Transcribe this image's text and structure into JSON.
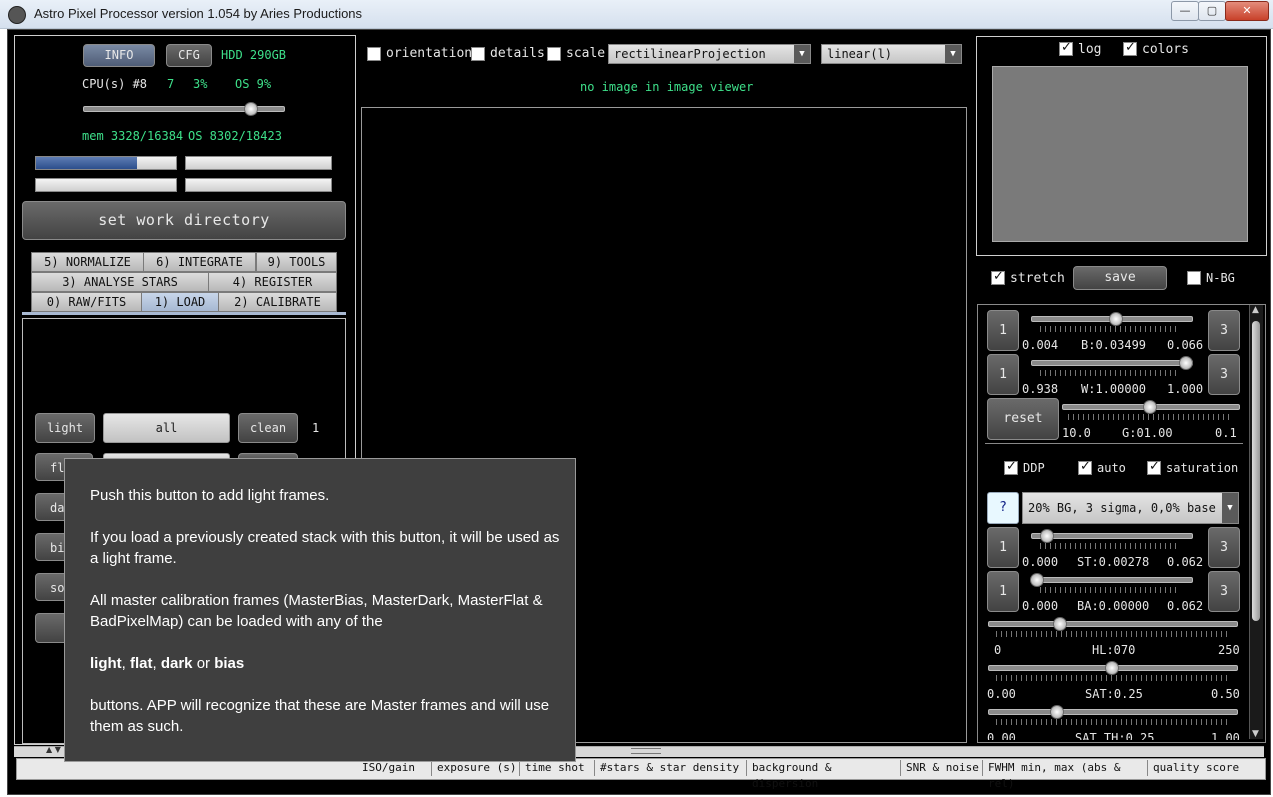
{
  "window": {
    "title": "Astro Pixel Processor version 1.054 by Aries Productions",
    "minimize_label": "—",
    "maximize_label": "▢",
    "close_label": "✕"
  },
  "sysinfo": {
    "info_label": "INFO",
    "cfg_label": "CFG",
    "hdd": "HDD 290GB",
    "cpu_label": "CPU(s) #8",
    "cpu_threads": "7",
    "cpu_pct": "3%",
    "os_cpu": "OS 9%",
    "mem": "mem 3328/16384",
    "os_mem": "OS 8302/18423",
    "thread_slider": 0.84,
    "progress_1": 0.72
  },
  "work_dir_label": "set work directory",
  "tabs": {
    "row1": [
      "5) NORMALIZE",
      "6) INTEGRATE",
      "9) TOOLS"
    ],
    "row2": [
      "3) ANALYSE STARS",
      "4) REGISTER"
    ],
    "row3": [
      "0) RAW/FITS",
      "1) LOAD",
      "2) CALIBRATE"
    ],
    "selected": "1) LOAD"
  },
  "load_panel": {
    "light_label": "light",
    "all_label": "all",
    "clean_label": "clean",
    "count": "1",
    "flat_partial": "fl",
    "dark_partial": "da",
    "bias_partial": "bi",
    "sort_partial": "so"
  },
  "viewer": {
    "orientation_label": "orientation",
    "details_label": "details",
    "scale_label": "scale",
    "projection": "rectilinearProjection",
    "stretch_mode": "linear(l)",
    "message": "no image in image viewer"
  },
  "histogram": {
    "log_label": "log",
    "colors_label": "colors",
    "log_checked": true,
    "colors_checked": true
  },
  "stretch_controls": {
    "stretch_label": "stretch",
    "save_label": "save",
    "nbg_label": "N-BG",
    "stretch_checked": true,
    "nbg_checked": false,
    "b_row": {
      "left": "1",
      "right": "3",
      "min": "0.004",
      "value": "B:0.03499",
      "max": "0.066",
      "pos": 0.53
    },
    "w_row": {
      "left": "1",
      "right": "3",
      "min": "0.938",
      "value": "W:1.00000",
      "max": "1.000",
      "pos": 0.97
    },
    "g_row": {
      "reset": "reset",
      "min": "10.0",
      "value": "G:01.00",
      "max": "0.1",
      "pos": 0.5
    },
    "ddp_label": "DDP",
    "auto_label": "auto",
    "saturation_label": "saturation",
    "ddp_checked": true,
    "auto_checked": true,
    "saturation_checked": true,
    "help_label": "?",
    "preset": "20% BG, 3 sigma, 0,0% base",
    "st_row": {
      "left": "1",
      "right": "3",
      "min": "0.000",
      "value": "ST:0.00278",
      "max": "0.062",
      "pos": 0.1
    },
    "ba_row": {
      "left": "1",
      "right": "3",
      "min": "0.000",
      "value": "BA:0.00000",
      "max": "0.062",
      "pos": 0.04
    },
    "hl_row": {
      "min": "0",
      "value": "HL:070",
      "max": "250",
      "pos": 0.29
    },
    "sat_row": {
      "min": "0.00",
      "value": "SAT:0.25",
      "max": "0.50",
      "pos": 0.5
    },
    "satth_row": {
      "min": "0.00",
      "value": "SAT TH:0.25",
      "max": "1.00",
      "pos": 0.28
    }
  },
  "table_headers": [
    "ISO/gain",
    "exposure (s)",
    "time shot",
    "#stars & star density",
    "background & dispersion",
    "SNR & noise",
    "FWHM min, max (abs & rel)",
    "quality score"
  ],
  "tooltip": {
    "p1": "Push this button to add light frames.",
    "p2": "If you load a previously created stack with this button, it will be used as a light frame.",
    "p3": "All master calibration frames (MasterBias, MasterDark, MasterFlat & BadPixelMap) can be loaded with any of the",
    "p4_light": "light",
    "p4_flat": "flat",
    "p4_dark": "dark",
    "p4_or": "or",
    "p4_bias": "bias",
    "p4_sep1": ", ",
    "p4_sep2": ", ",
    "p5": "buttons. APP will recognize that these are Master frames and will use them as such."
  }
}
